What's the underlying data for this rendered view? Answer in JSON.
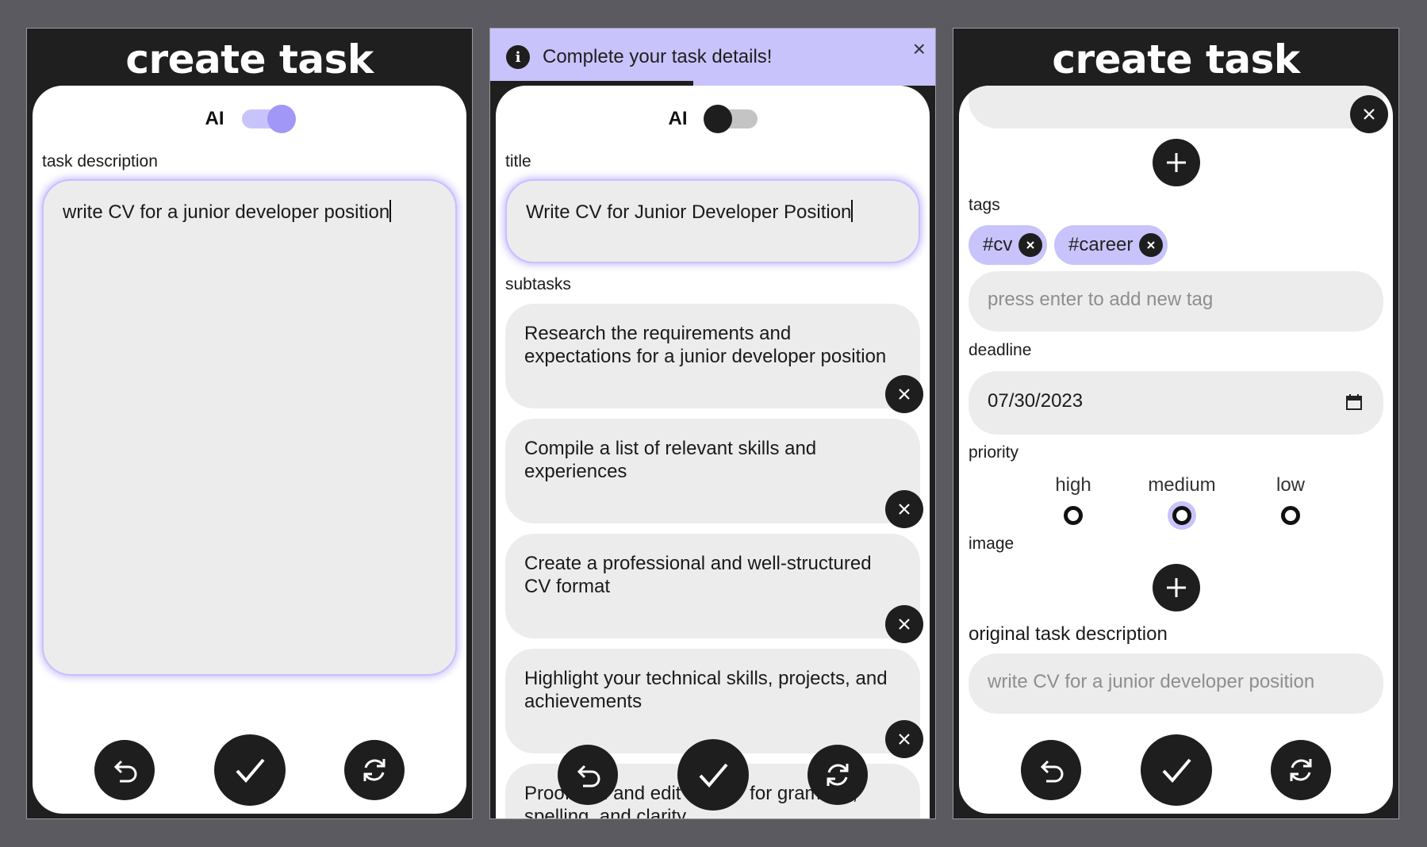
{
  "screen1": {
    "title": "create task",
    "ai_label": "AI",
    "ai_enabled": true,
    "description_label": "task description",
    "description_value": "write CV for a junior developer position"
  },
  "screen2": {
    "toast": {
      "message": "Complete your task details!",
      "icon": "info-icon",
      "close": "×"
    },
    "ai_label": "AI",
    "ai_enabled": false,
    "title_label": "title",
    "title_value": "Write CV for Junior Developer Position",
    "subtasks_label": "subtasks",
    "subtasks": [
      "Research the requirements and expectations for a junior developer position",
      "Compile a list of relevant skills and experiences",
      "Create a professional and well-structured CV format",
      "Highlight your technical skills, projects, and achievements",
      "Proofread and edit the CV for grammar, spelling, and clarity"
    ]
  },
  "screen3": {
    "title": "create task",
    "tags_label": "tags",
    "tags": [
      "#cv",
      "#career"
    ],
    "tag_placeholder": "press enter to add new tag",
    "deadline_label": "deadline",
    "deadline_value": "07/30/2023",
    "priority_label": "priority",
    "priority_options": [
      "high",
      "medium",
      "low"
    ],
    "priority_selected": "medium",
    "image_label": "image",
    "original_label": "original task description",
    "original_value": "write CV for a junior developer position"
  },
  "colors": {
    "accent": "#c9c3fb",
    "accent_strong": "#a197f7",
    "dark": "#1e1e1e",
    "field": "#ececec",
    "backdrop": "#5b5a60"
  },
  "bottom_actions": [
    "undo-icon",
    "check-icon",
    "refresh-icon"
  ]
}
